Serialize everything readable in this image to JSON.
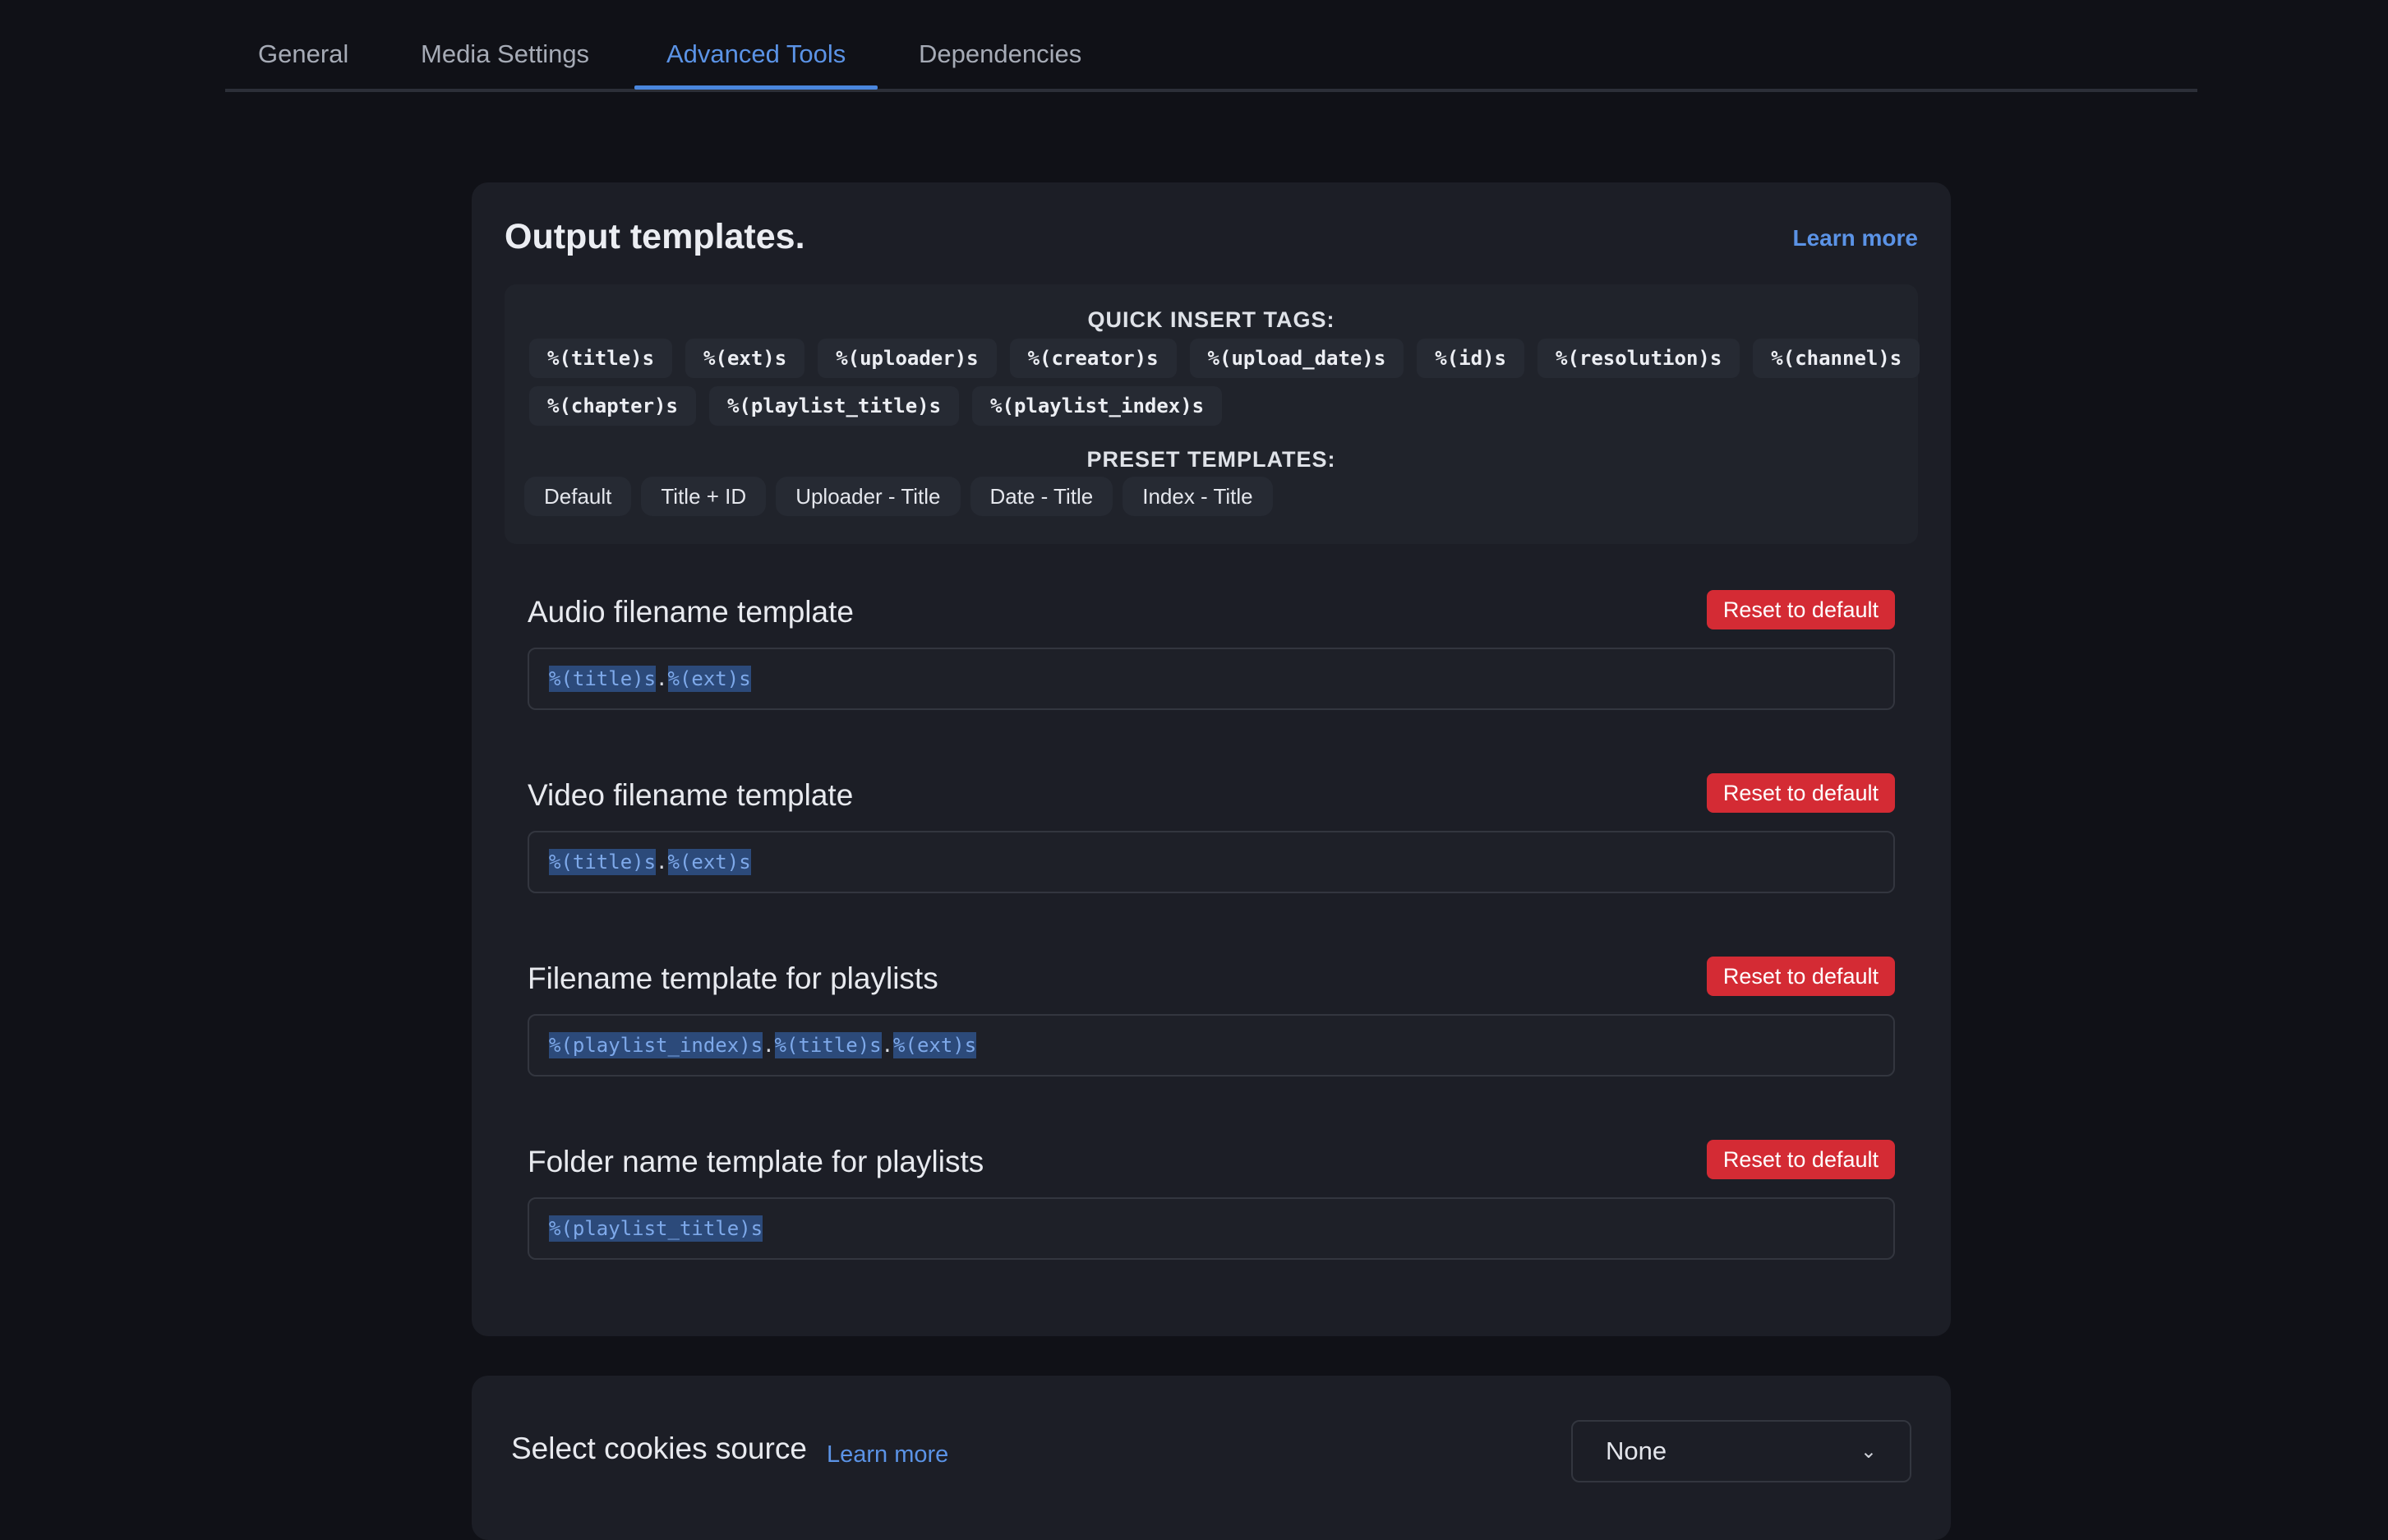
{
  "tabs": [
    {
      "label": "General"
    },
    {
      "label": "Media Settings"
    },
    {
      "label": "Advanced Tools",
      "active": true
    },
    {
      "label": "Dependencies"
    }
  ],
  "output_templates": {
    "title": "Output templates.",
    "learn_more": "Learn more",
    "quick_insert_heading": "QUICK INSERT TAGS:",
    "tags_row1": [
      "%(title)s",
      "%(ext)s",
      "%(uploader)s",
      "%(creator)s",
      "%(upload_date)s",
      "%(id)s",
      "%(resolution)s",
      "%(channel)s"
    ],
    "tags_row2": [
      "%(chapter)s",
      "%(playlist_title)s",
      "%(playlist_index)s"
    ],
    "preset_heading": "PRESET TEMPLATES:",
    "presets": [
      "Default",
      "Title + ID",
      "Uploader - Title",
      "Date - Title",
      "Index - Title"
    ],
    "reset_label": "Reset to default",
    "sections": [
      {
        "label": "Audio filename template",
        "tokens": [
          "%(title)s",
          ".",
          "%(ext)s"
        ]
      },
      {
        "label": "Video filename template",
        "tokens": [
          "%(title)s",
          ".",
          "%(ext)s"
        ]
      },
      {
        "label": "Filename template for playlists",
        "tokens": [
          "%(playlist_index)s",
          ".",
          "%(title)s",
          ".",
          "%(ext)s"
        ]
      },
      {
        "label": "Folder name template for playlists",
        "tokens": [
          "%(playlist_title)s"
        ]
      }
    ]
  },
  "cookies": {
    "label": "Select cookies source",
    "learn_more": "Learn more",
    "selected": "None"
  },
  "colors": {
    "accent": "#5b93e6",
    "danger": "#d42b34",
    "background": "#101117",
    "card": "#1c1e26"
  },
  "icons": {
    "dropdown": "chevron-down-icon"
  }
}
